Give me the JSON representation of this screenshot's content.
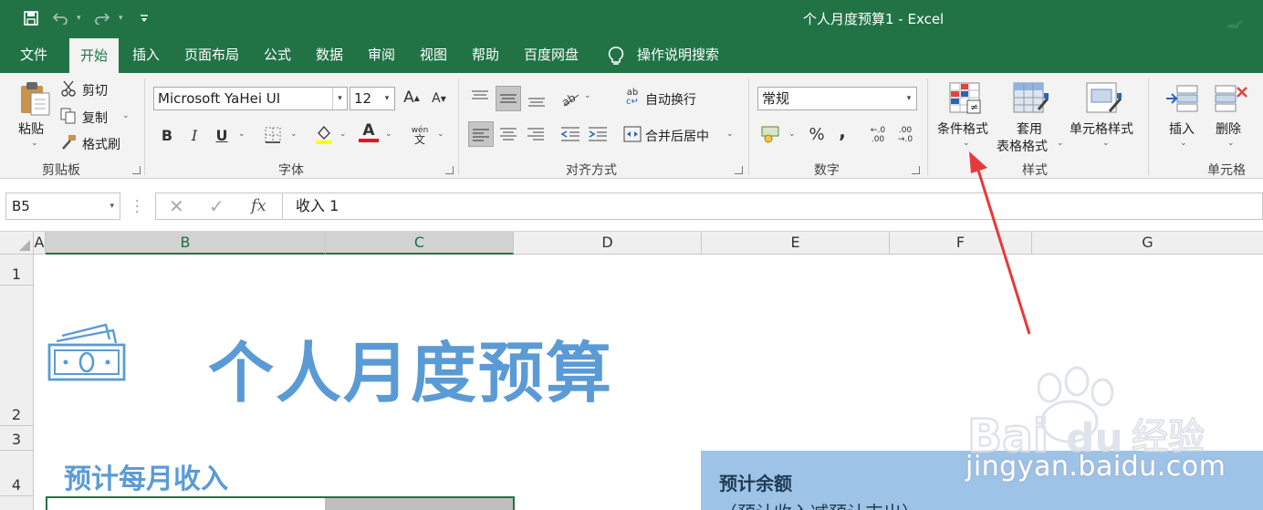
{
  "window": {
    "title": "个人月度预算1  -  Excel"
  },
  "menu": {
    "tabs": [
      "文件",
      "开始",
      "插入",
      "页面布局",
      "公式",
      "数据",
      "审阅",
      "视图",
      "帮助",
      "百度网盘"
    ],
    "tell_me": "操作说明搜索"
  },
  "ribbon": {
    "clipboard": {
      "paste": "粘贴",
      "cut": "剪切",
      "copy": "复制",
      "format_painter": "格式刷",
      "group_label": "剪贴板"
    },
    "font": {
      "name": "Microsoft YaHei UI",
      "size": "12",
      "bold": "B",
      "italic": "I",
      "underline": "U",
      "group_label": "字体",
      "phonetic": "wén"
    },
    "alignment": {
      "wrap_text": "自动换行",
      "merge_center": "合并后居中",
      "group_label": "对齐方式"
    },
    "number": {
      "format": "常规",
      "percent": "%",
      "comma": ",",
      "group_label": "数字"
    },
    "styles": {
      "conditional": "条件格式",
      "table_format_1": "套用",
      "table_format_2": "表格格式",
      "cell_styles": "单元格样式",
      "group_label": "样式"
    },
    "cells": {
      "insert": "插入",
      "delete": "删除",
      "group_label": "单元格"
    }
  },
  "formula_bar": {
    "name_box": "B5",
    "fx": "fx",
    "formula": "收入 1"
  },
  "grid": {
    "columns": [
      "A",
      "B",
      "C",
      "D",
      "E",
      "F",
      "G"
    ],
    "rows": [
      "1",
      "2",
      "3",
      "4"
    ],
    "selected_columns": [
      "B",
      "C"
    ]
  },
  "sheet": {
    "title": "个人月度预算",
    "section_income": "预计每月收入",
    "balance_title": "预计余额",
    "balance_subtitle": "（预计收入减预计支出）"
  },
  "watermark": {
    "text": "jingyan.baidu.com",
    "brand": "经验"
  },
  "colors": {
    "excel_green": "#217346",
    "title_blue": "#5b9bd5",
    "balance_fill": "#9dc3e6",
    "arrow_red": "#e8393a"
  }
}
